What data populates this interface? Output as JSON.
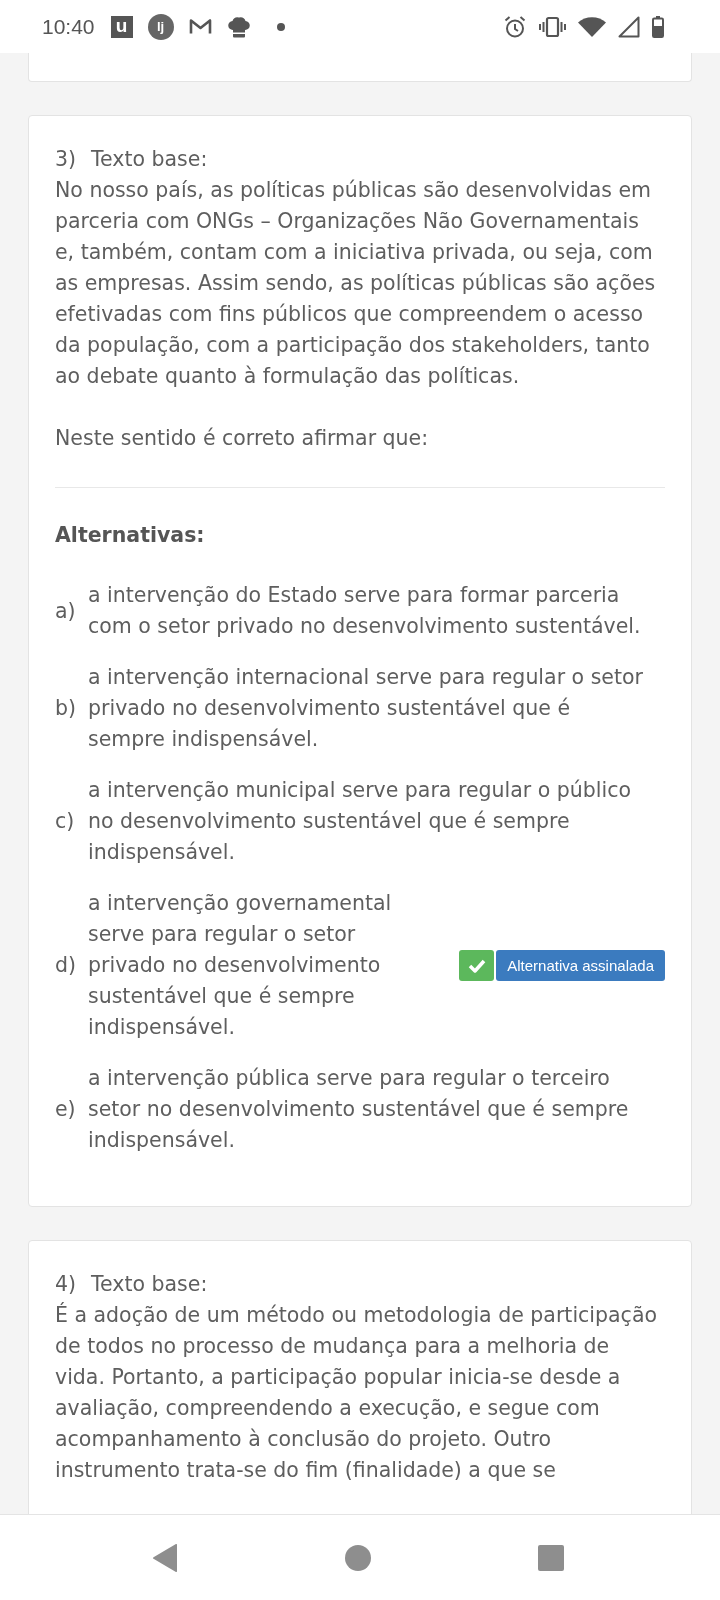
{
  "status_bar": {
    "time": "10:40",
    "app_icon_letters": [
      "u",
      "lj"
    ]
  },
  "questions": [
    {
      "number": "3)",
      "heading": "Texto base:",
      "text": "No nosso país, as políticas públicas são desenvolvidas em parceria com ONGs – Organizações Não Governamentais e, também, contam com a iniciativa privada, ou seja, com as empresas. Assim sendo, as políticas públicas são ações efetivadas com fins públicos que compreendem o acesso da população, com a participação dos stakeholders, tanto ao debate quanto à formulação das políticas.",
      "prompt": "Neste sentido é correto afirmar que:",
      "alternatives_title": "Alternativas:",
      "alternatives": [
        {
          "letter": "a)",
          "text": "a intervenção do Estado serve para formar parceria com o setor privado no desenvolvimento sustentável.",
          "selected": false
        },
        {
          "letter": "b)",
          "text": "a intervenção internacional serve para regular o setor privado no desenvolvimento sustentável que é sempre indispensável.",
          "selected": false
        },
        {
          "letter": "c)",
          "text": "a intervenção municipal serve para regular o público no desenvolvimento sustentável que é sempre indispensável.",
          "selected": false
        },
        {
          "letter": "d)",
          "text": "a intervenção governamental serve para regular o setor privado no desenvolvimento sustentável que é sempre indispensável.",
          "selected": true,
          "status_label": "Alternativa assinalada"
        },
        {
          "letter": "e)",
          "text": "a intervenção pública serve para regular o terceiro setor no desenvolvimento sustentável que é sempre indispensável.",
          "selected": false
        }
      ]
    },
    {
      "number": "4)",
      "heading": "Texto base:",
      "text": "É a adoção de um método ou metodologia de participação de todos no processo de mudança para a melhoria de vida. Portanto, a participação popular inicia-se desde a avaliação, compreendendo a execução, e segue com acompanhamento à conclusão do projeto. Outro instrumento trata-se do fim (finalidade) a que se"
    }
  ]
}
